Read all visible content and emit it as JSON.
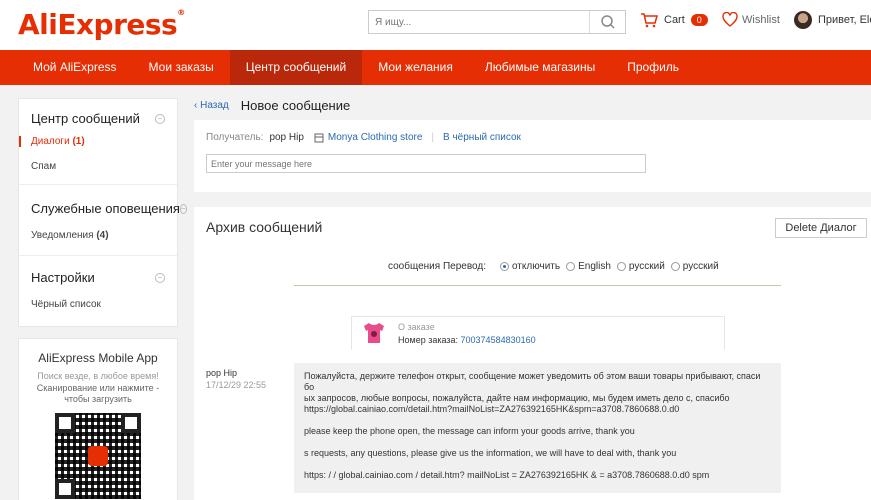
{
  "header": {
    "logo": "AliExpress",
    "logo_mark": "®",
    "search_placeholder": "Я ищу...",
    "cart_label": "Cart",
    "cart_count": "0",
    "wishlist_label": "Wishlist",
    "user_greeting": "Привет, Ele"
  },
  "nav": {
    "items": [
      "Мой AliExpress",
      "Мои заказы",
      "Центр сообщений",
      "Мои желания",
      "Любимые магазины",
      "Профиль"
    ],
    "active_index": 2
  },
  "sidebar": {
    "message_center": {
      "title": "Центр сообщений",
      "dialogs_label": "Диалоги",
      "dialogs_count": "(1)",
      "spam_label": "Спам"
    },
    "service": {
      "title": "Служебные оповещения",
      "notifications_label": "Уведомления",
      "notifications_count": "(4)"
    },
    "settings": {
      "title": "Настройки",
      "blacklist_label": "Чёрный список"
    },
    "collapse_symbol": "−"
  },
  "app_promo": {
    "title": "AliExpress Mobile App",
    "subtitle": "Поиск везде, в любое время!",
    "scan_line1": "Сканирование или нажмите -",
    "scan_line2": "чтобы загрузить"
  },
  "new_message": {
    "back_label": "Назад",
    "title": "Новое сообщение",
    "recipient_label": "Получатель:",
    "recipient_name": "pop Hip",
    "store_name": "Monya Clothing store",
    "separator": "|",
    "blacklist_link": "В чёрный список",
    "input_placeholder": "Enter your message here"
  },
  "archive": {
    "title": "Архив сообщений",
    "delete_button": "Delete Диалог",
    "translate_label": "сообщения Перевод:",
    "translate_options": [
      "отключить",
      "English",
      "русский",
      "русский"
    ],
    "translate_selected": 0,
    "order": {
      "label": "О заказе",
      "number_label": "Номер заказа:",
      "number": "700374584830160"
    },
    "message": {
      "sender": "pop Hip",
      "time": "17/12/29 22:55",
      "lines": [
        "Пожалуйста, держите телефон открыт, сообщение может уведомить об этом ваши товары прибывают, спаси",
        "бо",
        "ых запросов, любые вопросы, пожалуйста, дайте нам информацию, мы будем иметь дело с, спасибо",
        "https://global.cainiao.com/detail.htm?mailNoList=ZA276392165HK&spm=a3708.7860688.0.d0",
        "",
        "please keep the phone open, the message can inform your goods arrive, thank you",
        "",
        "s requests, any questions, please give us the information, we will have to deal with, thank you",
        "",
        "https: / / global.cainiao.com / detail.htm? mailNoList = ZA276392165HK & = a3708.7860688.0.d0 spm"
      ]
    }
  },
  "colors": {
    "brand": "#e62e04",
    "nav_active": "#b9280a",
    "link": "#2a6ab2"
  }
}
